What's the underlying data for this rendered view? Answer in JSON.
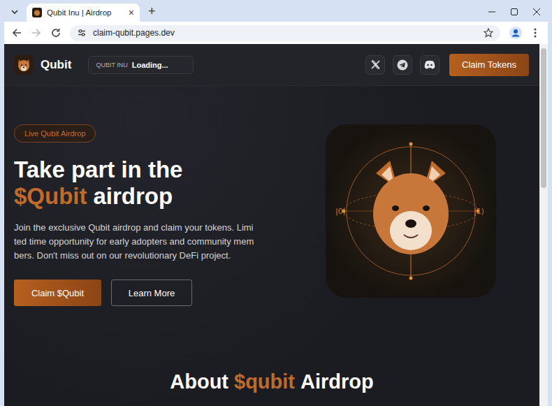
{
  "browser": {
    "tab": {
      "title": "Qubit Inu | Airdrop",
      "selected": true
    },
    "new_tab": "+",
    "close_tab": "×",
    "url": "claim-qubit.pages.dev",
    "nav": {
      "back_enabled": true,
      "forward_enabled": false
    },
    "bookmarked": false
  },
  "header": {
    "brand": "Qubit",
    "ticker": {
      "label": "QUBIT INU",
      "value": "Loading..."
    },
    "cta": "Claim Tokens"
  },
  "hero": {
    "badge": "Live Qubit Airdrop",
    "title_line1": "Take part in the",
    "title_highlight": "$Qubit",
    "title_rest": "airdrop",
    "description": "Join the exclusive Qubit airdrop and claim your tokens. Limited time opportunity for early adopters and community members. Don't miss out on our revolutionary DeFi project.",
    "buttons": [
      {
        "label": "Claim $Qubit",
        "kind": "primary"
      },
      {
        "label": "Learn More",
        "kind": "outline"
      }
    ],
    "image_labels": [
      "|0⟩",
      "|1⟩"
    ]
  },
  "about": {
    "prefix": "About",
    "highlight": "$qubit",
    "suffix": "Airdrop"
  },
  "scrollbar": {
    "level": 0.39
  }
}
